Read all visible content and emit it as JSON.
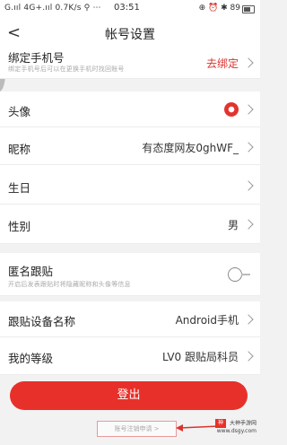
{
  "status_bar": {
    "left_text": "G.ııl 4G+.ııl 0.7K/s ⚲ ⋯",
    "time": "03:51",
    "right_text": "⊕ ⏰ ✱ 89"
  },
  "header": {
    "back_glyph": "<",
    "title": "帐号设置"
  },
  "phone_row": {
    "label": "绑定手机号",
    "sub_text": "绑定手机号后可以在更换手机时找回账号",
    "value": "去绑定"
  },
  "rows": [
    {
      "label": "头像",
      "value": ""
    },
    {
      "label": "昵称",
      "value": "有态度网友0ghWF_"
    },
    {
      "label": "生日",
      "value": ""
    },
    {
      "label": "性别",
      "value": "男"
    }
  ],
  "anon_row": {
    "label": "匿名跟贴",
    "sub_text": "开启后发表跟贴时将隐藏昵称和头像等信息"
  },
  "rows2": [
    {
      "label": "跟贴设备名称",
      "value": "Android手机"
    },
    {
      "label": "我的等级",
      "value": "LV0 跟贴局科员"
    }
  ],
  "logout_label": "登出",
  "bottom_link": "账号注销申请 >",
  "watermark": {
    "line1": "大神手游网",
    "line2": "www.dsgy.com"
  }
}
